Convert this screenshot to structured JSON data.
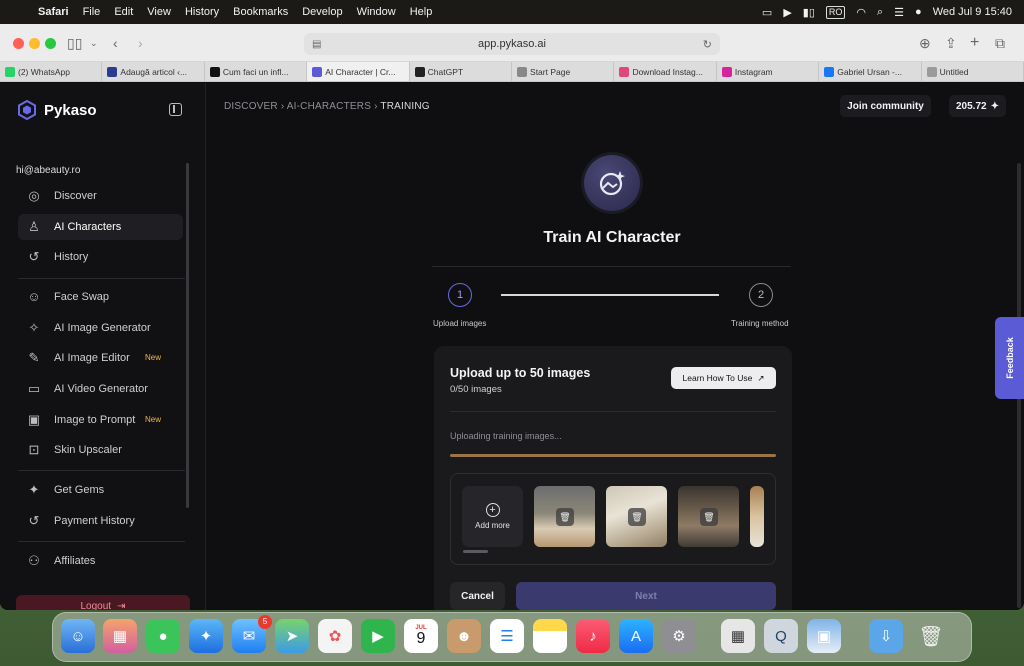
{
  "menubar": {
    "app": "Safari",
    "items": [
      "File",
      "Edit",
      "View",
      "History",
      "Bookmarks",
      "Develop",
      "Window",
      "Help"
    ],
    "input_source": "RO",
    "datetime": "Wed Jul 9  15:40"
  },
  "browser": {
    "url": "app.pykaso.ai",
    "tabs": [
      {
        "label": "(2) WhatsApp",
        "color": "#25d366"
      },
      {
        "label": "Adaugă articol ‹...",
        "color": "#2b3b8f"
      },
      {
        "label": "Cum faci un infl...",
        "color": "#111111"
      },
      {
        "label": "AI Character | Cr...",
        "color": "#5b5bd6",
        "active": true
      },
      {
        "label": "ChatGPT",
        "color": "#222222"
      },
      {
        "label": "Start Page",
        "color": "#888888"
      },
      {
        "label": "Download Instag...",
        "color": "#e0457b"
      },
      {
        "label": "Instagram",
        "color": "#d6249f"
      },
      {
        "label": "Gabriel Ursan -...",
        "color": "#1877f2"
      },
      {
        "label": "Untitled",
        "color": "#9a9a9a"
      }
    ]
  },
  "sidebar": {
    "brand": "Pykaso",
    "email": "hi@abeauty.ro",
    "items": [
      {
        "label": "Discover",
        "icon": "compass-icon",
        "glyph": "◎"
      },
      {
        "label": "AI Characters",
        "icon": "character-icon",
        "glyph": "♙",
        "active": true
      },
      {
        "label": "History",
        "icon": "history-icon",
        "glyph": "↺"
      },
      {
        "label": "Face Swap",
        "icon": "face-swap-icon",
        "glyph": "☺"
      },
      {
        "label": "AI Image Generator",
        "icon": "wand-icon",
        "glyph": "✧"
      },
      {
        "label": "AI Image Editor",
        "icon": "edit-icon",
        "glyph": "✎",
        "badge": "New"
      },
      {
        "label": "AI Video Generator",
        "icon": "video-icon",
        "glyph": "▭"
      },
      {
        "label": "Image to Prompt",
        "icon": "image-prompt-icon",
        "glyph": "▣",
        "badge": "New"
      },
      {
        "label": "Skin Upscaler",
        "icon": "upscale-icon",
        "glyph": "⊡"
      },
      {
        "label": "Get Gems",
        "icon": "sparkle-icon",
        "glyph": "✦"
      },
      {
        "label": "Payment History",
        "icon": "payment-history-icon",
        "glyph": "↺"
      },
      {
        "label": "Affiliates",
        "icon": "affiliates-icon",
        "glyph": "⚇"
      }
    ],
    "logout": "Logout"
  },
  "header": {
    "breadcrumb": [
      "DISCOVER",
      "AI-CHARACTERS",
      "TRAINING"
    ],
    "join_community": "Join community",
    "gems": "205.72"
  },
  "training": {
    "title": "Train AI Character",
    "steps": [
      {
        "number": "1",
        "label": "Upload images"
      },
      {
        "number": "2",
        "label": "Training method"
      }
    ],
    "card": {
      "title": "Upload up to 50 images",
      "count": "0/50 images",
      "learn_button": "Learn How To Use",
      "status": "Uploading training images...",
      "progress": 1.0,
      "add_more": "Add more",
      "cancel": "Cancel",
      "next": "Next"
    }
  },
  "feedback": "Feedback",
  "dock": {
    "mail_badge": "5",
    "calendar_month": "JUL",
    "calendar_day": "9"
  }
}
